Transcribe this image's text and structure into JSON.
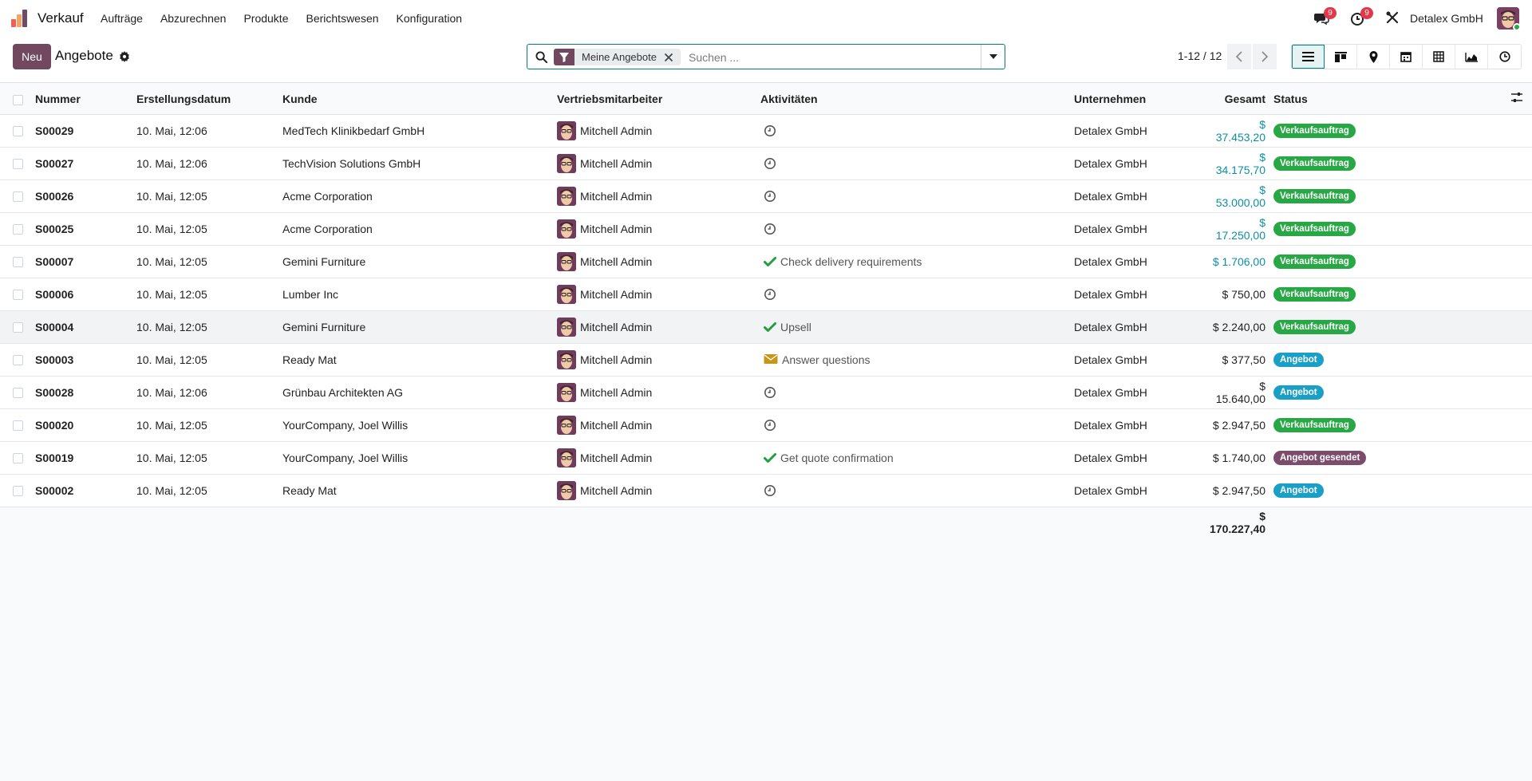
{
  "nav": {
    "app_name": "Verkauf",
    "menu": [
      "Aufträge",
      "Abzurechnen",
      "Produkte",
      "Berichtswesen",
      "Konfiguration"
    ],
    "messages_badge": "9",
    "activities_badge": "9",
    "company": "Detalex GmbH"
  },
  "control": {
    "new_label": "Neu",
    "title": "Angebote",
    "facet_label": "Meine Angebote",
    "search_placeholder": "Suchen ...",
    "pager": "1-12 / 12"
  },
  "columns": {
    "nummer": "Nummer",
    "datum": "Erstellungsdatum",
    "kunde": "Kunde",
    "vertrieb": "Vertriebsmitarbeiter",
    "aktivitaeten": "Aktivitäten",
    "unternehmen": "Unternehmen",
    "gesamt": "Gesamt",
    "status": "Status"
  },
  "rows": [
    {
      "nummer": "S00029",
      "datum": "10. Mai, 12:06",
      "kunde": "MedTech Klinikbedarf GmbH",
      "vertrieb": "Mitchell Admin",
      "activity_icon": "clock-icon",
      "activity": "",
      "unternehmen": "Detalex GmbH",
      "gesamt": "$ 37.453,20",
      "gesamt_teal": true,
      "status": "Verkaufsauftrag",
      "status_color": "#28a745"
    },
    {
      "nummer": "S00027",
      "datum": "10. Mai, 12:06",
      "kunde": "TechVision Solutions GmbH",
      "vertrieb": "Mitchell Admin",
      "activity_icon": "clock-icon",
      "activity": "",
      "unternehmen": "Detalex GmbH",
      "gesamt": "$ 34.175,70",
      "gesamt_teal": true,
      "status": "Verkaufsauftrag",
      "status_color": "#28a745"
    },
    {
      "nummer": "S00026",
      "datum": "10. Mai, 12:05",
      "kunde": "Acme Corporation",
      "vertrieb": "Mitchell Admin",
      "activity_icon": "clock-icon",
      "activity": "",
      "unternehmen": "Detalex GmbH",
      "gesamt": "$ 53.000,00",
      "gesamt_teal": true,
      "status": "Verkaufsauftrag",
      "status_color": "#28a745"
    },
    {
      "nummer": "S00025",
      "datum": "10. Mai, 12:05",
      "kunde": "Acme Corporation",
      "vertrieb": "Mitchell Admin",
      "activity_icon": "clock-icon",
      "activity": "",
      "unternehmen": "Detalex GmbH",
      "gesamt": "$ 17.250,00",
      "gesamt_teal": true,
      "status": "Verkaufsauftrag",
      "status_color": "#28a745"
    },
    {
      "nummer": "S00007",
      "datum": "10. Mai, 12:05",
      "kunde": "Gemini Furniture",
      "vertrieb": "Mitchell Admin",
      "activity_icon": "check-icon",
      "activity": "Check delivery requirements",
      "unternehmen": "Detalex GmbH",
      "gesamt": "$ 1.706,00",
      "gesamt_teal": true,
      "status": "Verkaufsauftrag",
      "status_color": "#28a745"
    },
    {
      "nummer": "S00006",
      "datum": "10. Mai, 12:05",
      "kunde": "Lumber Inc",
      "vertrieb": "Mitchell Admin",
      "activity_icon": "clock-icon",
      "activity": "",
      "unternehmen": "Detalex GmbH",
      "gesamt": "$ 750,00",
      "gesamt_teal": false,
      "status": "Verkaufsauftrag",
      "status_color": "#28a745"
    },
    {
      "nummer": "S00004",
      "datum": "10. Mai, 12:05",
      "kunde": "Gemini Furniture",
      "vertrieb": "Mitchell Admin",
      "activity_icon": "check-icon",
      "activity": "Upsell",
      "unternehmen": "Detalex GmbH",
      "gesamt": "$ 2.240,00",
      "gesamt_teal": false,
      "status": "Verkaufsauftrag",
      "status_color": "#28a745",
      "highlight": true
    },
    {
      "nummer": "S00003",
      "datum": "10. Mai, 12:05",
      "kunde": "Ready Mat",
      "vertrieb": "Mitchell Admin",
      "activity_icon": "envelope-icon",
      "activity": "Answer questions",
      "unternehmen": "Detalex GmbH",
      "gesamt": "$ 377,50",
      "gesamt_teal": false,
      "status": "Angebot",
      "status_color": "#1a9fc7"
    },
    {
      "nummer": "S00028",
      "datum": "10. Mai, 12:06",
      "kunde": "Grünbau Architekten AG",
      "vertrieb": "Mitchell Admin",
      "activity_icon": "clock-icon",
      "activity": "",
      "unternehmen": "Detalex GmbH",
      "gesamt": "$ 15.640,00",
      "gesamt_teal": false,
      "status": "Angebot",
      "status_color": "#1a9fc7"
    },
    {
      "nummer": "S00020",
      "datum": "10. Mai, 12:05",
      "kunde": "YourCompany, Joel Willis",
      "vertrieb": "Mitchell Admin",
      "activity_icon": "clock-icon",
      "activity": "",
      "unternehmen": "Detalex GmbH",
      "gesamt": "$ 2.947,50",
      "gesamt_teal": false,
      "status": "Verkaufsauftrag",
      "status_color": "#28a745"
    },
    {
      "nummer": "S00019",
      "datum": "10. Mai, 12:05",
      "kunde": "YourCompany, Joel Willis",
      "vertrieb": "Mitchell Admin",
      "activity_icon": "check-icon",
      "activity": "Get quote confirmation",
      "unternehmen": "Detalex GmbH",
      "gesamt": "$ 1.740,00",
      "gesamt_teal": false,
      "status": "Angebot gesendet",
      "status_color": "#7c4c6d"
    },
    {
      "nummer": "S00002",
      "datum": "10. Mai, 12:05",
      "kunde": "Ready Mat",
      "vertrieb": "Mitchell Admin",
      "activity_icon": "clock-icon",
      "activity": "",
      "unternehmen": "Detalex GmbH",
      "gesamt": "$ 2.947,50",
      "gesamt_teal": false,
      "status": "Angebot",
      "status_color": "#1a9fc7"
    }
  ],
  "total": "$ 170.227,40",
  "colors": {
    "brand": "#71485f",
    "teal_amount": "#0e8ea3",
    "search_border": "#017e84"
  }
}
